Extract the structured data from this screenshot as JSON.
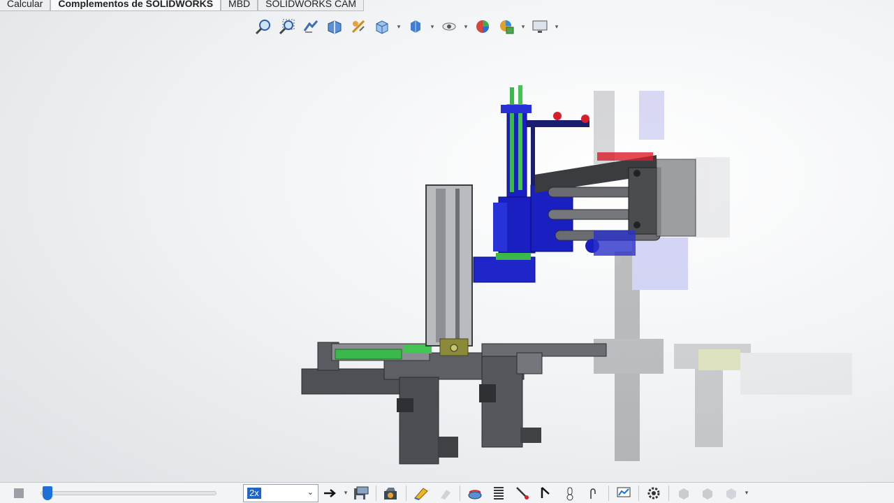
{
  "tabs": [
    {
      "label": "Calcular",
      "active": false
    },
    {
      "label": "Complementos de SOLIDWORKS",
      "active": true
    },
    {
      "label": "MBD",
      "active": false
    },
    {
      "label": "SOLIDWORKS CAM",
      "active": false
    }
  ],
  "view_toolbar": {
    "icons": [
      "zoom-to-fit-icon",
      "zoom-to-area-icon",
      "previous-view-icon",
      "section-view-icon",
      "dynamic-annotation-icon",
      "view-orientation-icon",
      "display-style-icon",
      "hide-show-items-icon",
      "edit-appearance-icon",
      "apply-scene-icon",
      "view-settings-icon"
    ]
  },
  "motion_toolbar": {
    "playback_speed": "2x",
    "icons": [
      "play-forward-icon",
      "save-animation-icon",
      "animation-wizard-icon",
      "autokey-icon",
      "add-key-icon",
      "motor-icon",
      "spring-icon",
      "contact-icon",
      "gravity-icon",
      "mate-icon",
      "results-plot-icon",
      "motion-study-settings-icon",
      "calc-icon-1",
      "calc-icon-2",
      "calc-icon-3"
    ]
  },
  "colors": {
    "accent": "#1e6fd9",
    "machine_gray": "#5f6166",
    "actuator_blue": "#1a1fc2",
    "cylinder_green": "#3bb84a",
    "sensor_red": "#d81e2a"
  }
}
